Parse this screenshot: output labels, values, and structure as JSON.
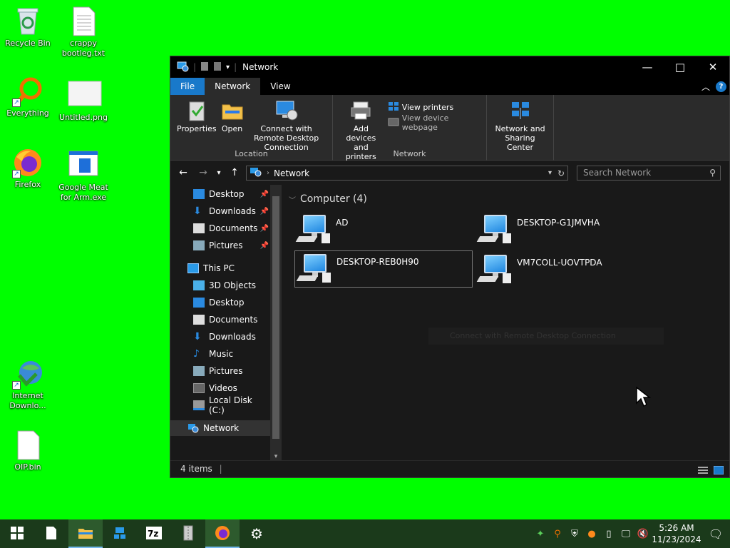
{
  "desktop": {
    "icons": [
      {
        "label": "Recycle Bin",
        "icon": "recycle-bin-icon"
      },
      {
        "label": "crappy bootleg.txt",
        "icon": "text-file-icon"
      },
      {
        "label": "Everything",
        "icon": "everything-search-icon"
      },
      {
        "label": "Untitled.png",
        "icon": "image-file-icon"
      },
      {
        "label": "Firefox",
        "icon": "firefox-icon"
      },
      {
        "label": "Google Meat for Arm.exe",
        "icon": "exe-file-icon"
      },
      {
        "label": "Internet Downlo...",
        "icon": "internet-download-manager-icon"
      },
      {
        "label": "OIP.bin",
        "icon": "bin-file-icon"
      }
    ]
  },
  "window": {
    "title": "Network",
    "controls": {
      "minimize": "—",
      "maximize": "□",
      "close": "✕"
    },
    "ribbon_tabs": [
      {
        "label": "File"
      },
      {
        "label": "Network"
      },
      {
        "label": "View"
      }
    ],
    "ribbon": {
      "location_group": {
        "label": "Location",
        "buttons": [
          {
            "label": "Properties"
          },
          {
            "label": "Open"
          },
          {
            "label": "Connect with Remote Desktop Connection"
          }
        ]
      },
      "network_group": {
        "label": "Network",
        "add_devices": "Add devices and printers",
        "view_printers": "View printers",
        "view_device_webpage": "View device webpage"
      },
      "sharing_group": {
        "button": "Network and Sharing Center"
      }
    },
    "address": {
      "path": "Network",
      "search_placeholder": "Search Network"
    },
    "nav_pane": {
      "quick_access": [
        {
          "label": "Desktop",
          "pinned": true
        },
        {
          "label": "Downloads",
          "pinned": true
        },
        {
          "label": "Documents",
          "pinned": true
        },
        {
          "label": "Pictures",
          "pinned": true
        }
      ],
      "this_pc": "This PC",
      "this_pc_items": [
        {
          "label": "3D Objects"
        },
        {
          "label": "Desktop"
        },
        {
          "label": "Documents"
        },
        {
          "label": "Downloads"
        },
        {
          "label": "Music"
        },
        {
          "label": "Pictures"
        },
        {
          "label": "Videos"
        },
        {
          "label": "Local Disk (C:)"
        }
      ],
      "network": "Network"
    },
    "content": {
      "group_header": "Computer (4)",
      "computers": [
        {
          "name": "AD"
        },
        {
          "name": "DESKTOP-G1JMVHA"
        },
        {
          "name": "DESKTOP-REB0H90",
          "selected": true
        },
        {
          "name": "VM7COLL-UOVTPDA"
        }
      ],
      "tooltip_ghost": "Connect with Remote Desktop Connection"
    },
    "status": {
      "items": "4 items"
    }
  },
  "taskbar": {
    "time": "5:26 AM",
    "date": "11/23/2024",
    "apps": [
      "start-icon",
      "notepad-icon",
      "file-explorer-icon",
      "network-tool-icon",
      "7zip-icon",
      "archive-icon",
      "firefox-icon",
      "settings-icon"
    ]
  },
  "colors": {
    "desktop_bg": "#00ff00",
    "accent": "#1979ca",
    "window_bg": "#191919"
  }
}
